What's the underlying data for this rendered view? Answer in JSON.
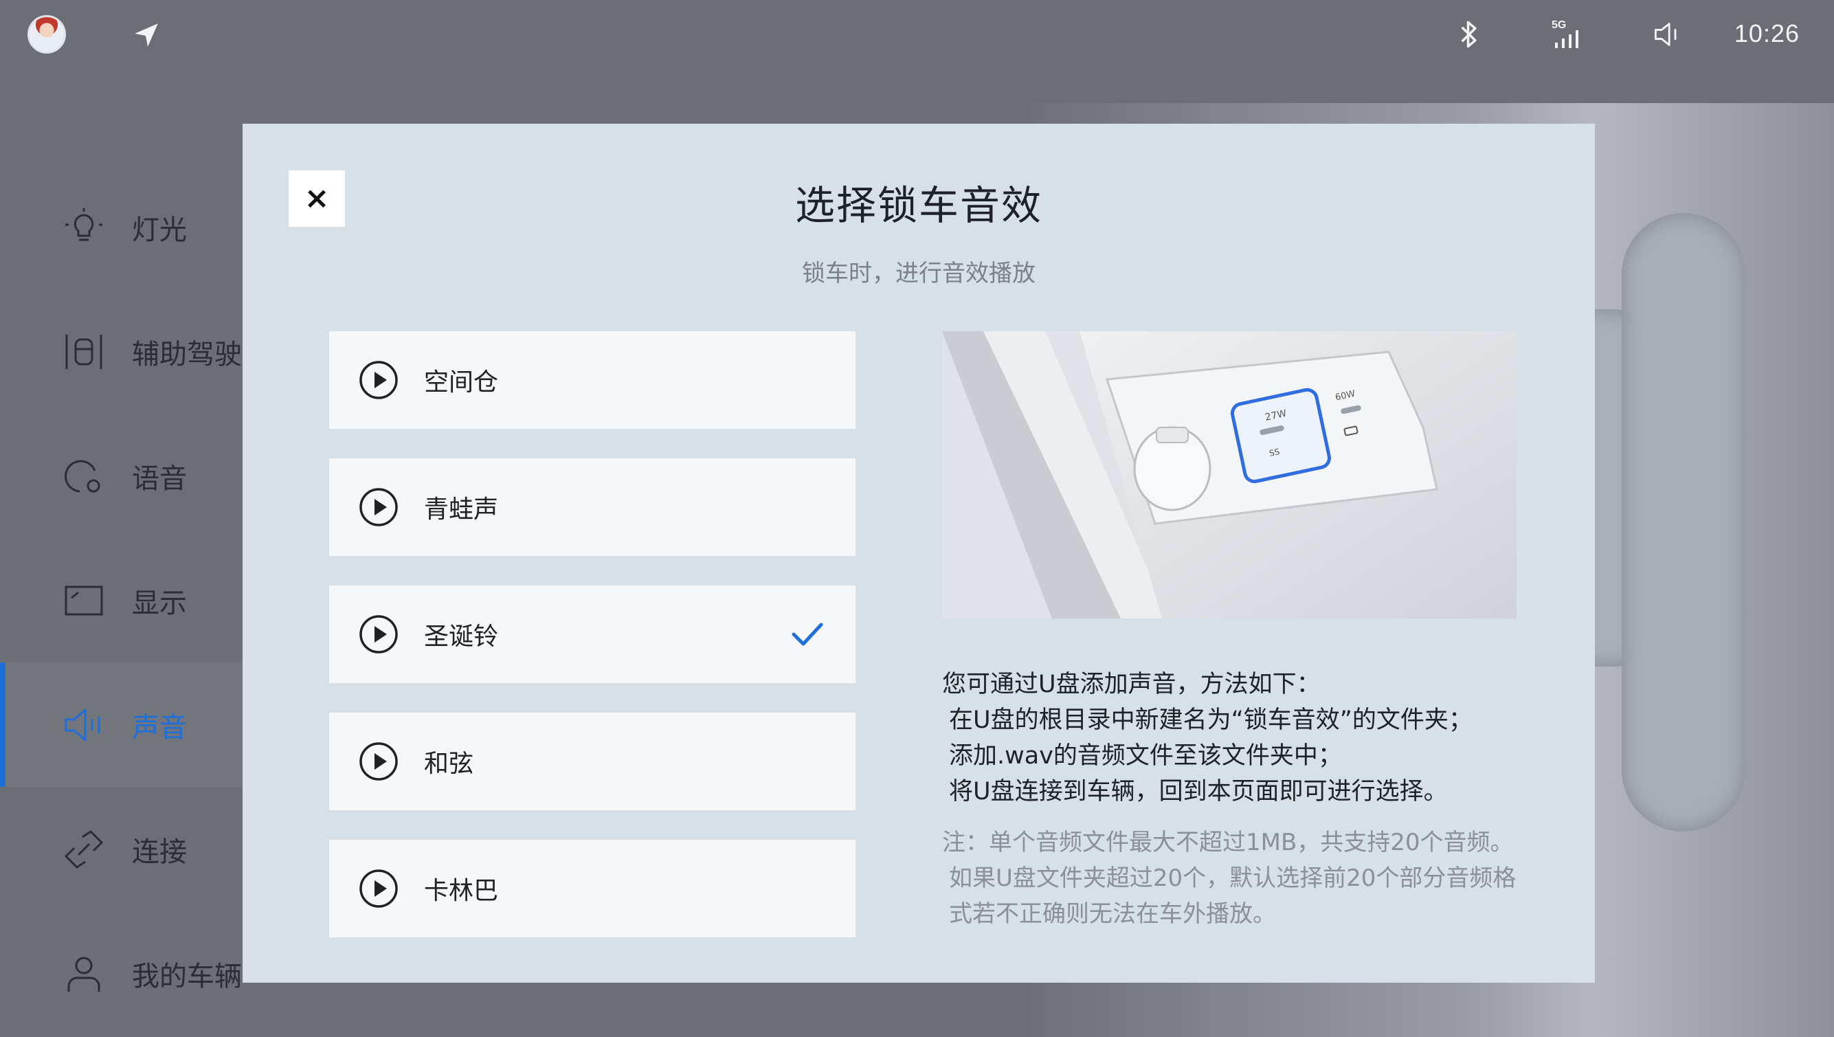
{
  "status_bar": {
    "time": "10:26",
    "network": "5G",
    "icons": [
      "avatar",
      "navigation-arrow-icon",
      "bluetooth-icon",
      "signal-5g-icon",
      "volume-icon"
    ]
  },
  "sidebar": {
    "items": [
      {
        "label": "灯光",
        "icon": "light-bulb-icon",
        "active": false
      },
      {
        "label": "辅助驾驶",
        "icon": "assist-driving-icon",
        "active": false
      },
      {
        "label": "语音",
        "icon": "voice-icon",
        "active": false
      },
      {
        "label": "显示",
        "icon": "display-icon",
        "active": false
      },
      {
        "label": "声音",
        "icon": "sound-icon",
        "active": true
      },
      {
        "label": "连接",
        "icon": "link-icon",
        "active": false
      },
      {
        "label": "我的车辆",
        "icon": "user-icon",
        "active": false
      }
    ]
  },
  "modal": {
    "close_label": "×",
    "title": "选择锁车音效",
    "subtitle": "锁车时，进行音效播放",
    "options": [
      {
        "name": "空间仓",
        "selected": false
      },
      {
        "name": "青蛙声",
        "selected": false
      },
      {
        "name": "圣诞铃",
        "selected": true
      },
      {
        "name": "和弦",
        "selected": false
      },
      {
        "name": "卡林巴",
        "selected": false
      }
    ],
    "image": {
      "port_left": "27W",
      "port_right": "60W",
      "port_left_sub": "SS"
    },
    "help": {
      "heading": "您可通过U盘添加声音，方法如下：",
      "steps": [
        "在U盘的根目录中新建名为“锁车音效”的文件夹；",
        "添加.wav的音频文件至该文件夹中；",
        "将U盘连接到车辆，回到本页面即可进行选择。"
      ],
      "note_lines": [
        "注：单个音频文件最大不超过1MB，共支持20个音频。",
        "如果U盘文件夹超过20个，默认选择前20个部分音频格",
        "式若不正确则无法在车外播放。"
      ]
    }
  },
  "colors": {
    "accent": "#1f6fd9",
    "modal_bg": "#d7dfe7",
    "page_bg": "#6b6f75",
    "option_bg": "#f6f7f8"
  }
}
